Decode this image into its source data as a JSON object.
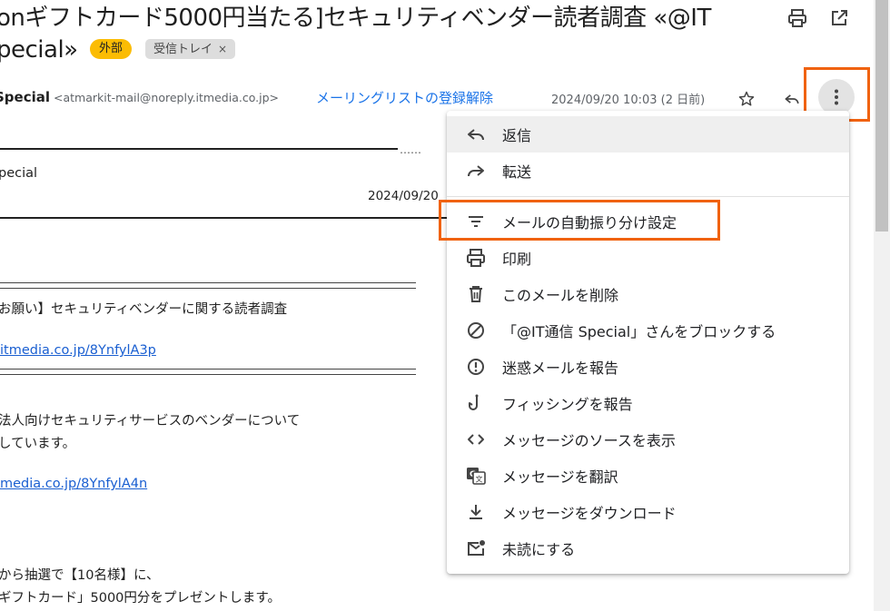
{
  "subject": {
    "line1": "onギフトカード5000円当たる]セキュリティベンダー読者調査 «@IT",
    "line2": "pecial»"
  },
  "labels": {
    "external": "外部",
    "inbox": "受信トレイ",
    "inbox_close": "×"
  },
  "sender": {
    "name": "Special",
    "email": "<atmarkit-mail@noreply.itmedia.co.jp>",
    "unsubscribe": "メーリングリストの登録解除",
    "date": "2024/09/20 10:03 (2 日前)"
  },
  "body": {
    "dots": "……",
    "special": "pecial",
    "date_right": "2024/09/20",
    "request_heading": "お願い】セキュリティベンダーに関する読者調査",
    "link1": "itmedia.co.jp/8YnfylA3p",
    "para1_line1": "法人向けセキュリティサービスのベンダーについて",
    "para1_line2": "しています。",
    "link2": "media.co.jp/8YnfylA4n",
    "para2_line1": "から抽選で【10名様】に、",
    "para2_line2": "ギフトカード」5000円分をプレゼントします。"
  },
  "menu": {
    "items": [
      {
        "label": "返信",
        "icon": "reply-icon"
      },
      {
        "label": "転送",
        "icon": "forward-icon"
      },
      {
        "label": "メールの自動振り分け設定",
        "icon": "filter-icon"
      },
      {
        "label": "印刷",
        "icon": "print-icon"
      },
      {
        "label": "このメールを削除",
        "icon": "trash-icon"
      },
      {
        "label": "「@IT通信 Special」さんをブロックする",
        "icon": "block-icon"
      },
      {
        "label": "迷惑メールを報告",
        "icon": "spam-icon"
      },
      {
        "label": "フィッシングを報告",
        "icon": "phishing-hook-icon"
      },
      {
        "label": "メッセージのソースを表示",
        "icon": "code-icon"
      },
      {
        "label": "メッセージを翻訳",
        "icon": "translate-icon"
      },
      {
        "label": "メッセージをダウンロード",
        "icon": "download-icon"
      },
      {
        "label": "未読にする",
        "icon": "mark-unread-icon"
      }
    ]
  },
  "colors": {
    "highlight_box": "#f0620f",
    "external_chip": "#fbbc04",
    "link": "#1a5fd1"
  }
}
